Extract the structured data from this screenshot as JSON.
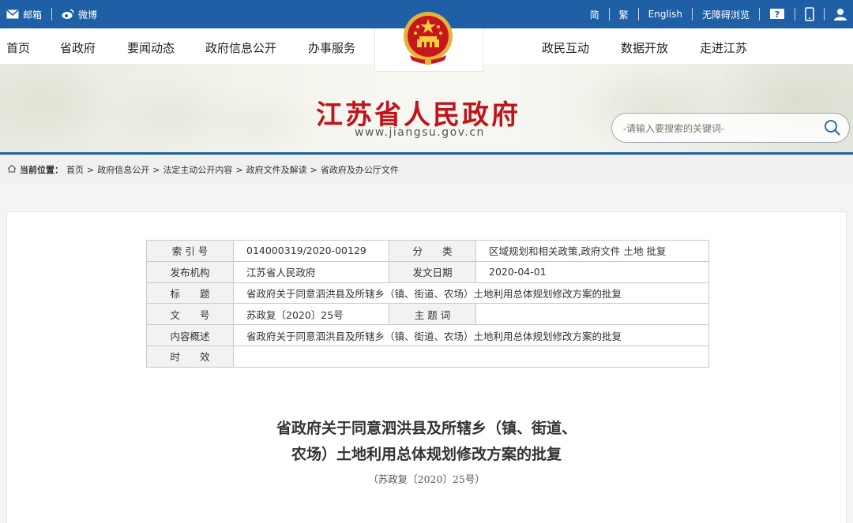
{
  "topbar": {
    "mail_label": "邮箱",
    "weibo_label": "微博",
    "simplified": "简",
    "traditional": "繁",
    "english": "English",
    "accessibility": "无障碍浏览"
  },
  "nav": {
    "left": [
      "首页",
      "省政府",
      "要闻动态",
      "政府信息公开",
      "办事服务"
    ],
    "right": [
      "政民互动",
      "数据开放",
      "走进江苏"
    ]
  },
  "banner": {
    "title": "江苏省人民政府",
    "url": "www.jiangsu.gov.cn",
    "search_placeholder": "-请输入要搜索的关键词-"
  },
  "breadcrumb": {
    "prefix": "当前位置：",
    "items": [
      "首页",
      "政府信息公开",
      "法定主动公开内容",
      "政府文件及解读",
      "省政府及办公厅文件"
    ],
    "separator": ">"
  },
  "meta": {
    "rows": [
      {
        "l1": "索 引 号",
        "v1": "014000319/2020-00129",
        "l2": "分　　类",
        "v2": "区域规划和相关政策,政府文件 土地 批复"
      },
      {
        "l1": "发布机构",
        "v1": "江苏省人民政府",
        "l2": "发文日期",
        "v2": "2020-04-01"
      },
      {
        "l1": "标　　题",
        "v": "省政府关于同意泗洪县及所辖乡（镇、街道、农场）土地利用总体规划修改方案的批复"
      },
      {
        "l1": "文　　号",
        "v1": "苏政复〔2020〕25号",
        "l2": "主 题 词",
        "v2": ""
      },
      {
        "l1": "内容概述",
        "v": "省政府关于同意泗洪县及所辖乡（镇、街道、农场）土地利用总体规划修改方案的批复"
      },
      {
        "l1": "时　　效",
        "v": ""
      }
    ]
  },
  "document": {
    "title_line1": "省政府关于同意泗洪县及所辖乡（镇、街道、",
    "title_line2": "农场）土地利用总体规划修改方案的批复",
    "doc_number": "（苏政复〔2020〕25号）"
  },
  "colors": {
    "brand_blue": "#1f5fa6",
    "title_red": "#c0141b"
  }
}
